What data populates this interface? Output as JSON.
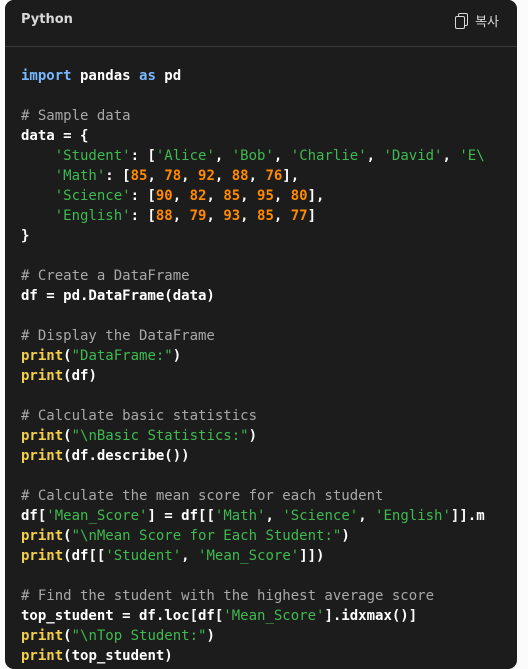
{
  "header": {
    "language": "Python",
    "copy_label": "복사",
    "copy_icon": "copy-icon"
  },
  "colors": {
    "background": "#1c1c1c",
    "keyword": "#79b8ff",
    "comment": "#a8a8a8",
    "string": "#3fb950",
    "number": "#ff8a00",
    "function": "#f2d04b",
    "text": "#ffffff"
  },
  "code_lines": [
    [
      [
        "kw",
        "import"
      ],
      [
        "plain",
        " pandas "
      ],
      [
        "kw",
        "as"
      ],
      [
        "plain",
        " pd"
      ]
    ],
    [],
    [
      [
        "comment",
        "# Sample data"
      ]
    ],
    [
      [
        "plain",
        "data = {"
      ]
    ],
    [
      [
        "plain",
        "    "
      ],
      [
        "str",
        "'Student'"
      ],
      [
        "plain",
        ": ["
      ],
      [
        "str",
        "'Alice'"
      ],
      [
        "plain",
        ", "
      ],
      [
        "str",
        "'Bob'"
      ],
      [
        "plain",
        ", "
      ],
      [
        "str",
        "'Charlie'"
      ],
      [
        "plain",
        ", "
      ],
      [
        "str",
        "'David'"
      ],
      [
        "plain",
        ", "
      ],
      [
        "str",
        "'E\\"
      ]
    ],
    [
      [
        "plain",
        "    "
      ],
      [
        "str",
        "'Math'"
      ],
      [
        "plain",
        ": ["
      ],
      [
        "num",
        "85"
      ],
      [
        "plain",
        ", "
      ],
      [
        "num",
        "78"
      ],
      [
        "plain",
        ", "
      ],
      [
        "num",
        "92"
      ],
      [
        "plain",
        ", "
      ],
      [
        "num",
        "88"
      ],
      [
        "plain",
        ", "
      ],
      [
        "num",
        "76"
      ],
      [
        "plain",
        "],"
      ]
    ],
    [
      [
        "plain",
        "    "
      ],
      [
        "str",
        "'Science'"
      ],
      [
        "plain",
        ": ["
      ],
      [
        "num",
        "90"
      ],
      [
        "plain",
        ", "
      ],
      [
        "num",
        "82"
      ],
      [
        "plain",
        ", "
      ],
      [
        "num",
        "85"
      ],
      [
        "plain",
        ", "
      ],
      [
        "num",
        "95"
      ],
      [
        "plain",
        ", "
      ],
      [
        "num",
        "80"
      ],
      [
        "plain",
        "],"
      ]
    ],
    [
      [
        "plain",
        "    "
      ],
      [
        "str",
        "'English'"
      ],
      [
        "plain",
        ": ["
      ],
      [
        "num",
        "88"
      ],
      [
        "plain",
        ", "
      ],
      [
        "num",
        "79"
      ],
      [
        "plain",
        ", "
      ],
      [
        "num",
        "93"
      ],
      [
        "plain",
        ", "
      ],
      [
        "num",
        "85"
      ],
      [
        "plain",
        ", "
      ],
      [
        "num",
        "77"
      ],
      [
        "plain",
        "]"
      ]
    ],
    [
      [
        "plain",
        "}"
      ]
    ],
    [],
    [
      [
        "comment",
        "# Create a DataFrame"
      ]
    ],
    [
      [
        "plain",
        "df = pd.DataFrame(data)"
      ]
    ],
    [],
    [
      [
        "comment",
        "# Display the DataFrame"
      ]
    ],
    [
      [
        "fn",
        "print"
      ],
      [
        "plain",
        "("
      ],
      [
        "str",
        "\"DataFrame:\""
      ],
      [
        "plain",
        ")"
      ]
    ],
    [
      [
        "fn",
        "print"
      ],
      [
        "plain",
        "(df)"
      ]
    ],
    [],
    [
      [
        "comment",
        "# Calculate basic statistics"
      ]
    ],
    [
      [
        "fn",
        "print"
      ],
      [
        "plain",
        "("
      ],
      [
        "str",
        "\"\\nBasic Statistics:\""
      ],
      [
        "plain",
        ")"
      ]
    ],
    [
      [
        "fn",
        "print"
      ],
      [
        "plain",
        "(df.describe())"
      ]
    ],
    [],
    [
      [
        "comment",
        "# Calculate the mean score for each student"
      ]
    ],
    [
      [
        "plain",
        "df["
      ],
      [
        "str",
        "'Mean_Score'"
      ],
      [
        "plain",
        "] = df[["
      ],
      [
        "str",
        "'Math'"
      ],
      [
        "plain",
        ", "
      ],
      [
        "str",
        "'Science'"
      ],
      [
        "plain",
        ", "
      ],
      [
        "str",
        "'English'"
      ],
      [
        "plain",
        "]].m"
      ]
    ],
    [
      [
        "fn",
        "print"
      ],
      [
        "plain",
        "("
      ],
      [
        "str",
        "\"\\nMean Score for Each Student:\""
      ],
      [
        "plain",
        ")"
      ]
    ],
    [
      [
        "fn",
        "print"
      ],
      [
        "plain",
        "(df[["
      ],
      [
        "str",
        "'Student'"
      ],
      [
        "plain",
        ", "
      ],
      [
        "str",
        "'Mean_Score'"
      ],
      [
        "plain",
        "]])"
      ]
    ],
    [],
    [
      [
        "comment",
        "# Find the student with the highest average score"
      ]
    ],
    [
      [
        "plain",
        "top_student = df.loc[df["
      ],
      [
        "str",
        "'Mean_Score'"
      ],
      [
        "plain",
        "].idxmax()]"
      ]
    ],
    [
      [
        "fn",
        "print"
      ],
      [
        "plain",
        "("
      ],
      [
        "str",
        "\"\\nTop Student:\""
      ],
      [
        "plain",
        ")"
      ]
    ],
    [
      [
        "fn",
        "print"
      ],
      [
        "plain",
        "(top_student)"
      ]
    ]
  ]
}
